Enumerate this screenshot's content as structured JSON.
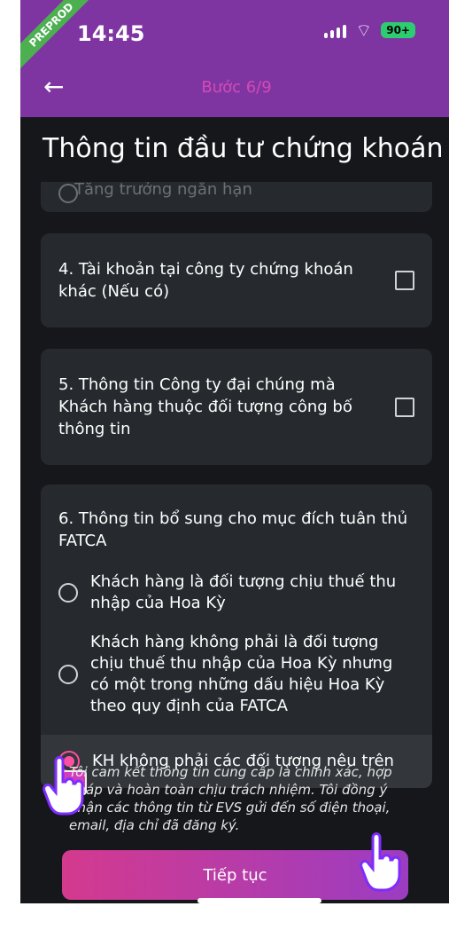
{
  "status_bar": {
    "badge": "PREPROD",
    "time": "14:45",
    "battery": "90+"
  },
  "header": {
    "step": "Bước 6/9"
  },
  "page": {
    "title": "Thông tin đầu tư chứng khoán"
  },
  "top_card": {
    "partial_option": "Tăng trưởng ngắn hạn"
  },
  "items": [
    {
      "label": "4. Tài khoản tại công ty chứng khoán khác (Nếu có)"
    },
    {
      "label": "5. Thông tin Công ty đại chúng mà Khách hàng thuộc đối tượng công bố thông tin"
    }
  ],
  "fatca": {
    "title": "6. Thông tin bổ sung cho mục đích tuân thủ FATCA",
    "options": [
      "Khách hàng là đối tượng chịu thuế thu nhập của Hoa Kỳ",
      "Khách hàng không phải là đối tượng chịu thuế thu nhập của Hoa Kỳ nhưng có một trong những dấu hiệu Hoa Kỳ theo quy định của FATCA",
      "KH không phải các đối tượng nêu trên"
    ]
  },
  "commitment": {
    "text": "Tôi cam kết thông tin cung cấp là chính xác, hợp pháp và hoàn toàn chịu trách nhiệm. Tôi đồng ý nhận các thông tin từ EVS gửi đến số điện thoại, email, địa chỉ đã đăng ký."
  },
  "actions": {
    "continue_label": "Tiếp tục"
  },
  "colors": {
    "header_bg": "#7e35a2",
    "accent": "#ff4fa1",
    "card_bg": "#262a2e"
  },
  "icons": {
    "back": "arrow-left-icon",
    "hand": "pointing-hand-icon"
  }
}
